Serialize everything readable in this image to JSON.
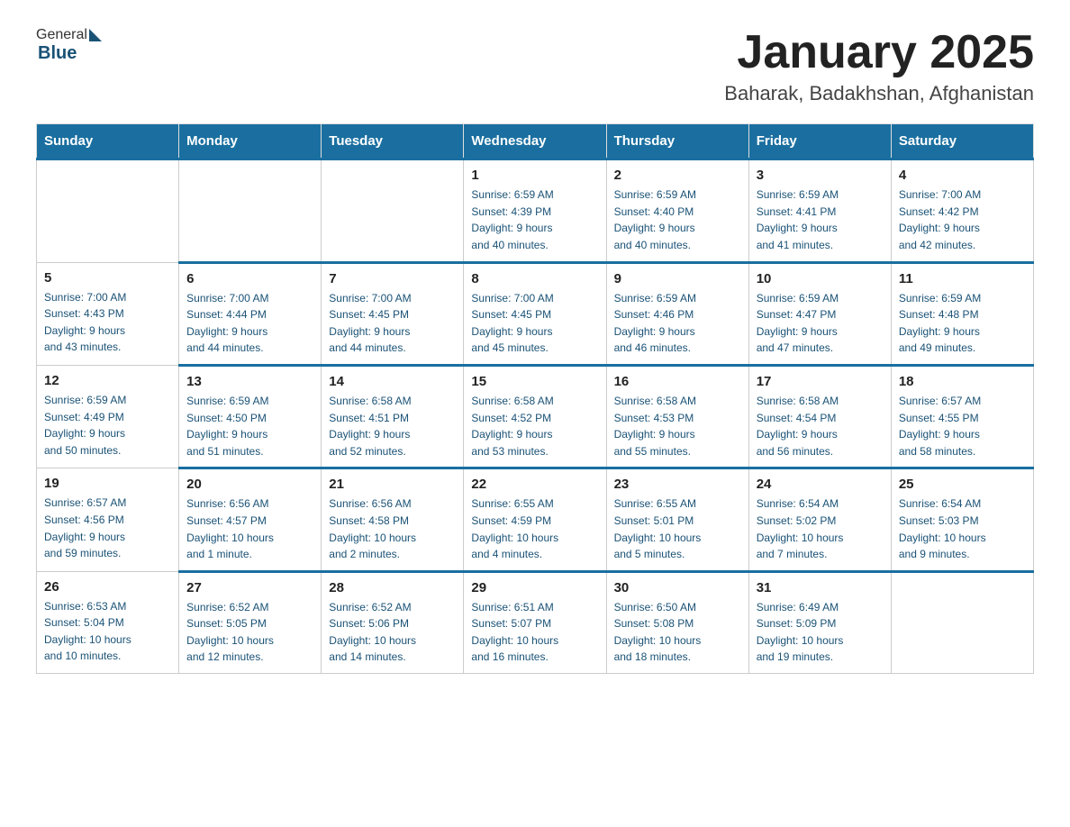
{
  "header": {
    "logo_general": "General",
    "logo_blue": "Blue",
    "title": "January 2025",
    "subtitle": "Baharak, Badakhshan, Afghanistan"
  },
  "days_of_week": [
    "Sunday",
    "Monday",
    "Tuesday",
    "Wednesday",
    "Thursday",
    "Friday",
    "Saturday"
  ],
  "weeks": [
    [
      {
        "day": "",
        "info": ""
      },
      {
        "day": "",
        "info": ""
      },
      {
        "day": "",
        "info": ""
      },
      {
        "day": "1",
        "info": "Sunrise: 6:59 AM\nSunset: 4:39 PM\nDaylight: 9 hours\nand 40 minutes."
      },
      {
        "day": "2",
        "info": "Sunrise: 6:59 AM\nSunset: 4:40 PM\nDaylight: 9 hours\nand 40 minutes."
      },
      {
        "day": "3",
        "info": "Sunrise: 6:59 AM\nSunset: 4:41 PM\nDaylight: 9 hours\nand 41 minutes."
      },
      {
        "day": "4",
        "info": "Sunrise: 7:00 AM\nSunset: 4:42 PM\nDaylight: 9 hours\nand 42 minutes."
      }
    ],
    [
      {
        "day": "5",
        "info": "Sunrise: 7:00 AM\nSunset: 4:43 PM\nDaylight: 9 hours\nand 43 minutes."
      },
      {
        "day": "6",
        "info": "Sunrise: 7:00 AM\nSunset: 4:44 PM\nDaylight: 9 hours\nand 44 minutes."
      },
      {
        "day": "7",
        "info": "Sunrise: 7:00 AM\nSunset: 4:45 PM\nDaylight: 9 hours\nand 44 minutes."
      },
      {
        "day": "8",
        "info": "Sunrise: 7:00 AM\nSunset: 4:45 PM\nDaylight: 9 hours\nand 45 minutes."
      },
      {
        "day": "9",
        "info": "Sunrise: 6:59 AM\nSunset: 4:46 PM\nDaylight: 9 hours\nand 46 minutes."
      },
      {
        "day": "10",
        "info": "Sunrise: 6:59 AM\nSunset: 4:47 PM\nDaylight: 9 hours\nand 47 minutes."
      },
      {
        "day": "11",
        "info": "Sunrise: 6:59 AM\nSunset: 4:48 PM\nDaylight: 9 hours\nand 49 minutes."
      }
    ],
    [
      {
        "day": "12",
        "info": "Sunrise: 6:59 AM\nSunset: 4:49 PM\nDaylight: 9 hours\nand 50 minutes."
      },
      {
        "day": "13",
        "info": "Sunrise: 6:59 AM\nSunset: 4:50 PM\nDaylight: 9 hours\nand 51 minutes."
      },
      {
        "day": "14",
        "info": "Sunrise: 6:58 AM\nSunset: 4:51 PM\nDaylight: 9 hours\nand 52 minutes."
      },
      {
        "day": "15",
        "info": "Sunrise: 6:58 AM\nSunset: 4:52 PM\nDaylight: 9 hours\nand 53 minutes."
      },
      {
        "day": "16",
        "info": "Sunrise: 6:58 AM\nSunset: 4:53 PM\nDaylight: 9 hours\nand 55 minutes."
      },
      {
        "day": "17",
        "info": "Sunrise: 6:58 AM\nSunset: 4:54 PM\nDaylight: 9 hours\nand 56 minutes."
      },
      {
        "day": "18",
        "info": "Sunrise: 6:57 AM\nSunset: 4:55 PM\nDaylight: 9 hours\nand 58 minutes."
      }
    ],
    [
      {
        "day": "19",
        "info": "Sunrise: 6:57 AM\nSunset: 4:56 PM\nDaylight: 9 hours\nand 59 minutes."
      },
      {
        "day": "20",
        "info": "Sunrise: 6:56 AM\nSunset: 4:57 PM\nDaylight: 10 hours\nand 1 minute."
      },
      {
        "day": "21",
        "info": "Sunrise: 6:56 AM\nSunset: 4:58 PM\nDaylight: 10 hours\nand 2 minutes."
      },
      {
        "day": "22",
        "info": "Sunrise: 6:55 AM\nSunset: 4:59 PM\nDaylight: 10 hours\nand 4 minutes."
      },
      {
        "day": "23",
        "info": "Sunrise: 6:55 AM\nSunset: 5:01 PM\nDaylight: 10 hours\nand 5 minutes."
      },
      {
        "day": "24",
        "info": "Sunrise: 6:54 AM\nSunset: 5:02 PM\nDaylight: 10 hours\nand 7 minutes."
      },
      {
        "day": "25",
        "info": "Sunrise: 6:54 AM\nSunset: 5:03 PM\nDaylight: 10 hours\nand 9 minutes."
      }
    ],
    [
      {
        "day": "26",
        "info": "Sunrise: 6:53 AM\nSunset: 5:04 PM\nDaylight: 10 hours\nand 10 minutes."
      },
      {
        "day": "27",
        "info": "Sunrise: 6:52 AM\nSunset: 5:05 PM\nDaylight: 10 hours\nand 12 minutes."
      },
      {
        "day": "28",
        "info": "Sunrise: 6:52 AM\nSunset: 5:06 PM\nDaylight: 10 hours\nand 14 minutes."
      },
      {
        "day": "29",
        "info": "Sunrise: 6:51 AM\nSunset: 5:07 PM\nDaylight: 10 hours\nand 16 minutes."
      },
      {
        "day": "30",
        "info": "Sunrise: 6:50 AM\nSunset: 5:08 PM\nDaylight: 10 hours\nand 18 minutes."
      },
      {
        "day": "31",
        "info": "Sunrise: 6:49 AM\nSunset: 5:09 PM\nDaylight: 10 hours\nand 19 minutes."
      },
      {
        "day": "",
        "info": ""
      }
    ]
  ]
}
